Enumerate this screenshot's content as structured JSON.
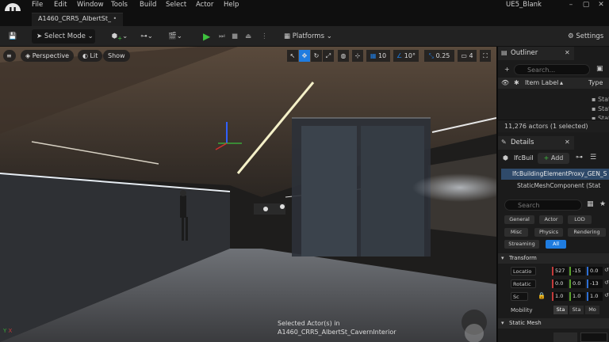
{
  "menubar": {
    "items": [
      "File",
      "Edit",
      "Window",
      "Tools",
      "Build",
      "Select",
      "Actor",
      "Help"
    ],
    "project_name": "UE5_Blank",
    "logo_letter": "U"
  },
  "tab": {
    "level_name": "A1460_CRR5_AlbertSt_"
  },
  "toolbar": {
    "select_mode": "Select Mode",
    "platforms": "Platforms",
    "settings": "Settings"
  },
  "viewport": {
    "perspective": "Perspective",
    "lit": "Lit",
    "show": "Show",
    "grid_snap": "10",
    "rot_snap": "10°",
    "scale_snap": "0.25",
    "camera_speed": "4",
    "selected_line1": "Selected Actor(s) in",
    "selected_line2": "A1460_CRR5_AlbertSt_CavernInterior"
  },
  "outliner": {
    "title": "Outliner",
    "search_placeholder": "Search...",
    "col_label": "Item Label",
    "col_type": "Type",
    "rows": [
      "Static",
      "Static",
      "Static"
    ],
    "count": "11,276 actors (1 selected)"
  },
  "details": {
    "title": "Details",
    "actor_name": "IfcBuil",
    "add_label": "Add",
    "selected_item": "IfcBuildingElementProxy_GEN_S",
    "component": "StaticMeshComponent (Stat",
    "search_placeholder": "Search",
    "filters_row1": [
      "General",
      "Actor",
      "LOD"
    ],
    "filters_row2": [
      "Misc",
      "Physics",
      "Rendering"
    ],
    "filters_row3": [
      "Streaming",
      "All"
    ],
    "transform_header": "Transform",
    "location_label": "Locatio",
    "rotation_label": "Rotatic",
    "scale_label": "Sc",
    "location": [
      "527",
      "-15",
      "0.0"
    ],
    "rotation": [
      "0.0",
      "0.0",
      "-13"
    ],
    "scale": [
      "1.0",
      "1.0",
      "1.0"
    ],
    "mobility_label": "Mobility",
    "mobility_options": [
      "Sta",
      "Sta",
      "Mo"
    ],
    "static_mesh_header": "Static Mesh"
  },
  "colors": {
    "accent": "#1f7ce0",
    "play": "#3ec13e"
  }
}
